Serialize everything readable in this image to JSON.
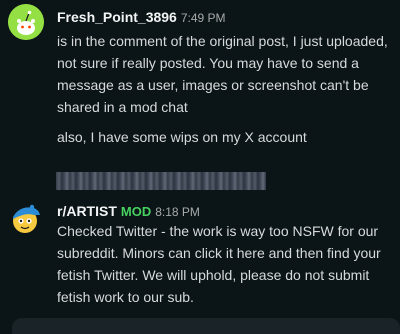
{
  "messages": [
    {
      "author": "Fresh_Point_3896",
      "time": "7:49 PM",
      "lines": [
        "is in the comment of the original post, I just uploaded, not sure if really posted. You may have to send a message as a user, images or screenshot can't be shared in a mod chat",
        "also, I have some wips on my X account"
      ]
    },
    {
      "author": "r/ARTIST",
      "badge": "MOD",
      "time": "8:18 PM",
      "text": "Checked Twitter - the work is way too NSFW for our subreddit. Minors can click it here and then find your fetish Twitter. We will uphold, please do not submit fetish work to our sub."
    }
  ],
  "colors": {
    "background": "#0b1416",
    "mod_badge": "#46d160",
    "avatar1": "#94e044"
  }
}
